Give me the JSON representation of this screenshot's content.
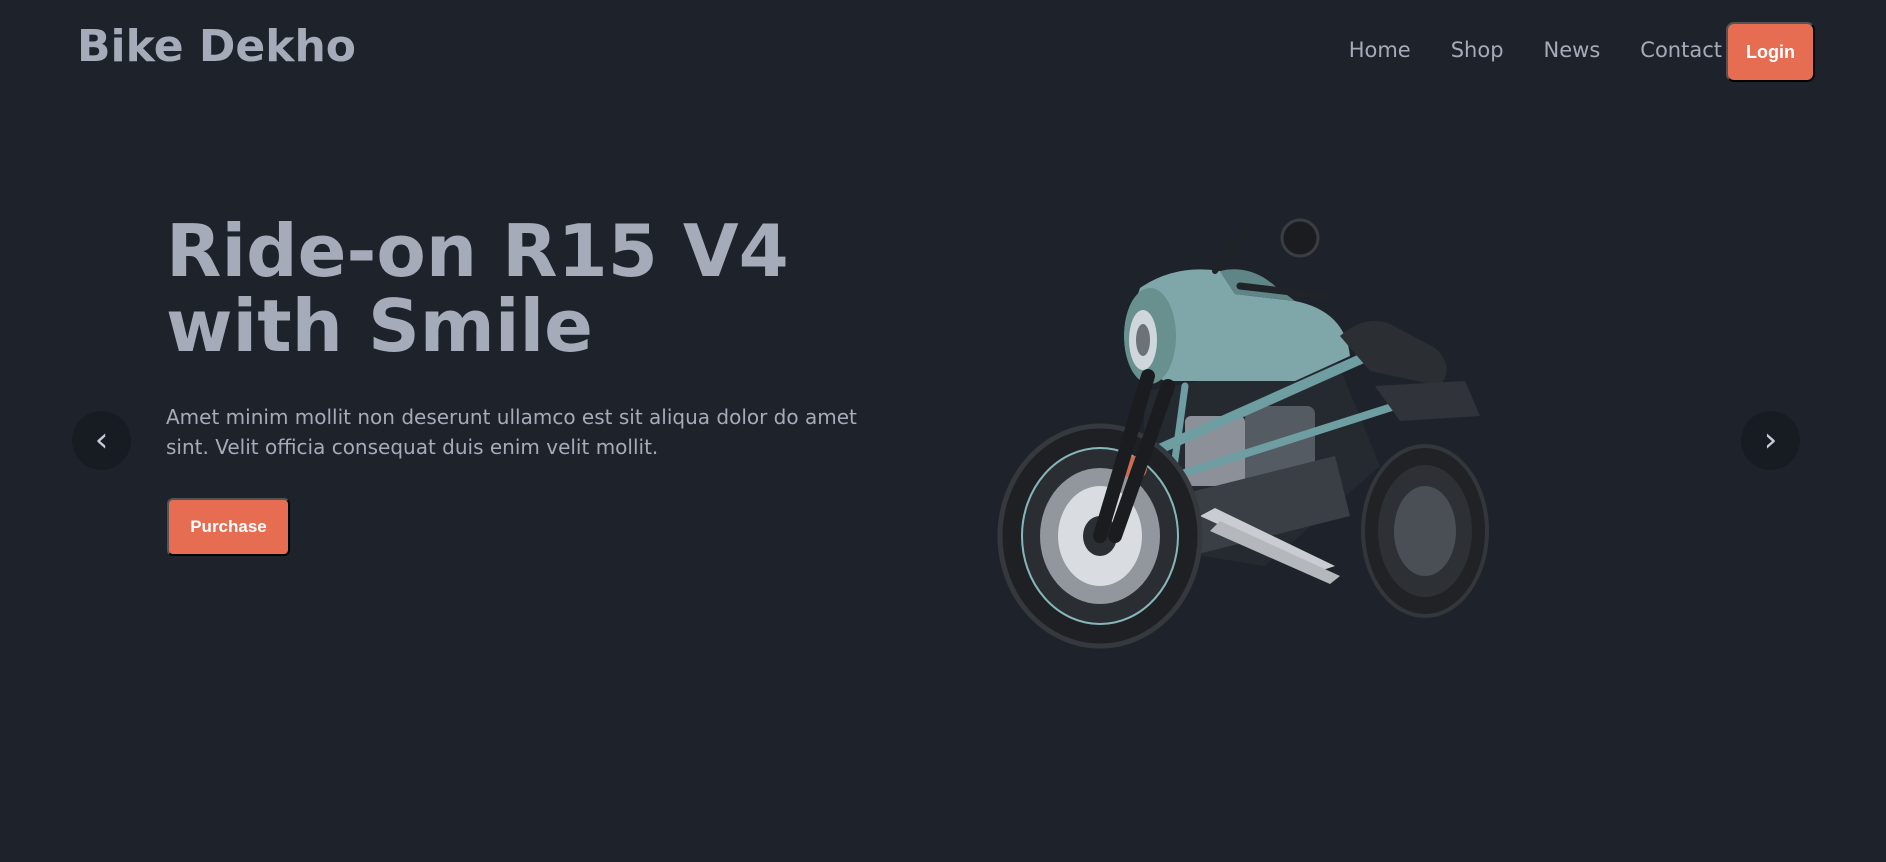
{
  "navbar": {
    "brand": "Bike Dekho",
    "links": [
      {
        "label": "Home"
      },
      {
        "label": "Shop"
      },
      {
        "label": "News"
      },
      {
        "label": "Contact"
      }
    ],
    "login_label": "Login"
  },
  "hero": {
    "title_line1": "Ride-on R15 V4",
    "title_line2": "with Smile",
    "description": "Amet minim mollit non deserunt ullamco est sit aliqua dolor do amet sint. Velit officia consequat duis enim velit mollit.",
    "purchase_label": "Purchase"
  },
  "carousel": {
    "prev_icon": "chevron-left-icon",
    "next_icon": "chevron-right-icon",
    "prev_glyph": "‹",
    "next_glyph": "›"
  },
  "colors": {
    "background": "#1e232b",
    "accent": "#e66d52",
    "text": "#a5abb8",
    "bike_body": "#7fa6a8"
  },
  "image": {
    "subject": "motorcycle-image"
  }
}
